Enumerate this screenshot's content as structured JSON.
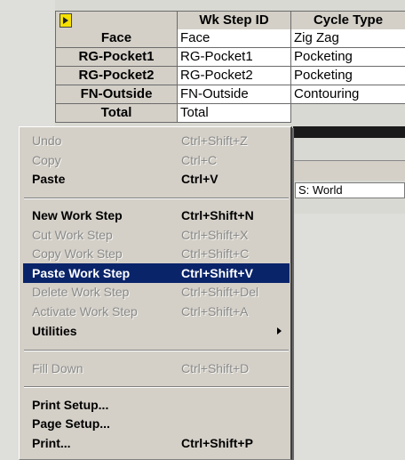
{
  "grid": {
    "header": {
      "col_id": "Wk Step ID",
      "col_type": "Cycle Type"
    },
    "rows": [
      {
        "name": "Face",
        "id": "Face",
        "type": "Zig Zag"
      },
      {
        "name": "RG-Pocket1",
        "id": "RG-Pocket1",
        "type": "Pocketing"
      },
      {
        "name": "RG-Pocket2",
        "id": "RG-Pocket2",
        "type": "Pocketing"
      },
      {
        "name": "FN-Outside",
        "id": "FN-Outside",
        "type": "Contouring"
      }
    ],
    "partial_row": {
      "name": "Total",
      "id": "Total"
    }
  },
  "world_field": {
    "value": "S: World"
  },
  "menu": {
    "items": [
      {
        "label": "Undo",
        "shortcut": "Ctrl+Shift+Z",
        "enabled": false
      },
      {
        "label": "Copy",
        "shortcut": "Ctrl+C",
        "enabled": false
      },
      {
        "label": "Paste",
        "shortcut": "Ctrl+V",
        "enabled": true
      },
      {
        "label": "New Work Step",
        "shortcut": "Ctrl+Shift+N",
        "enabled": true
      },
      {
        "label": "Cut Work Step",
        "shortcut": "Ctrl+Shift+X",
        "enabled": false
      },
      {
        "label": "Copy Work Step",
        "shortcut": "Ctrl+Shift+C",
        "enabled": false
      },
      {
        "label": "Paste Work Step",
        "shortcut": "Ctrl+Shift+V",
        "enabled": true,
        "selected": true
      },
      {
        "label": "Delete Work Step",
        "shortcut": "Ctrl+Shift+Del",
        "enabled": false
      },
      {
        "label": "Activate Work Step",
        "shortcut": "Ctrl+Shift+A",
        "enabled": false
      },
      {
        "label": "Utilities",
        "shortcut": "",
        "enabled": true,
        "submenu": true
      },
      {
        "label": "Fill Down",
        "shortcut": "Ctrl+Shift+D",
        "enabled": false
      },
      {
        "label": "Print Setup...",
        "shortcut": "",
        "enabled": true
      },
      {
        "label": "Page Setup...",
        "shortcut": "",
        "enabled": true
      },
      {
        "label": "Print...",
        "shortcut": "Ctrl+Shift+P",
        "enabled": true
      }
    ]
  },
  "colors": {
    "selection": "#0a246a",
    "menu_bg": "#d4d0c8",
    "disabled_text": "#8a8a8a"
  },
  "icons": {
    "corner": "select-all-icon",
    "submenu": "submenu-arrow-icon"
  }
}
